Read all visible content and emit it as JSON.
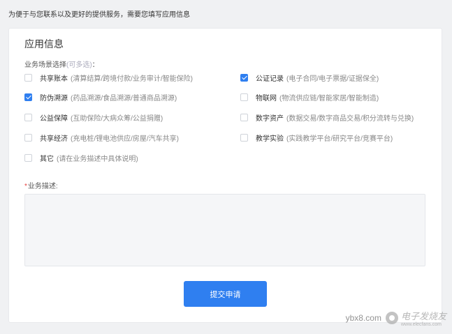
{
  "notice": "为便于与您联系以及更好的提供服务，需要您填写应用信息",
  "card": {
    "title": "应用信息",
    "scene_label": "业务场景选择",
    "scene_hint": "(可多选)",
    "scene_colon": "：",
    "options": [
      {
        "name": "共享账本",
        "desc": "(清算结算/跨境付款/业务审计/智能保险)",
        "checked": false
      },
      {
        "name": "公证记录",
        "desc": "(电子合同/电子票据/证据保全)",
        "checked": true
      },
      {
        "name": "防伪溯源",
        "desc": "(药品溯源/食品溯源/普通商品溯源)",
        "checked": true
      },
      {
        "name": "物联网",
        "desc": "(物流供应链/智能家居/智能制造)",
        "checked": false
      },
      {
        "name": "公益保障",
        "desc": "(互助保险/大病众筹/公益捐赠)",
        "checked": false
      },
      {
        "name": "数字资产",
        "desc": "(数据交易/数字商品交易/积分流转与兑换)",
        "checked": false
      },
      {
        "name": "共享经济",
        "desc": "(充电桩/锂电池供应/房屋/汽车共享)",
        "checked": false
      },
      {
        "name": "教学实验",
        "desc": "(实践教学平台/研究平台/竞赛平台)",
        "checked": false
      },
      {
        "name": "其它",
        "desc": "(请在业务描述中具体说明)",
        "checked": false
      }
    ],
    "desc_required": "*",
    "desc_label": "业务描述:",
    "desc_value": "",
    "submit_label": "提交申请"
  },
  "watermark": {
    "text": "ybx8.com",
    "brand": "电子发烧友",
    "site": "www.elecfans.com"
  }
}
